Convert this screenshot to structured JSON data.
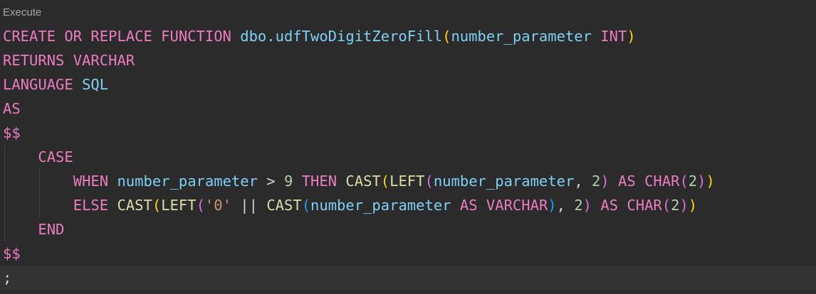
{
  "codelens": {
    "label": "Execute"
  },
  "lines": [
    {
      "tokens": [
        {
          "t": "CREATE OR REPLACE FUNCTION ",
          "c": "keyword"
        },
        {
          "t": "dbo.udfTwoDigitZeroFill",
          "c": "ident"
        },
        {
          "t": "(",
          "c": "paren"
        },
        {
          "t": "number_parameter ",
          "c": "ident"
        },
        {
          "t": "INT",
          "c": "type"
        },
        {
          "t": ")",
          "c": "paren"
        }
      ]
    },
    {
      "tokens": [
        {
          "t": "RETURNS ",
          "c": "keyword"
        },
        {
          "t": "VARCHAR",
          "c": "type"
        }
      ]
    },
    {
      "tokens": [
        {
          "t": "LANGUAGE ",
          "c": "keyword"
        },
        {
          "t": "SQL",
          "c": "ident"
        }
      ]
    },
    {
      "tokens": [
        {
          "t": "AS",
          "c": "keyword"
        }
      ]
    },
    {
      "tokens": [
        {
          "t": "$$",
          "c": "dollar"
        }
      ]
    },
    {
      "indent": 1,
      "tokens": [
        {
          "t": "CASE",
          "c": "keyword"
        }
      ]
    },
    {
      "indent": 2,
      "tokens": [
        {
          "t": "WHEN ",
          "c": "keyword"
        },
        {
          "t": "number_parameter ",
          "c": "ident"
        },
        {
          "t": "> ",
          "c": "op"
        },
        {
          "t": "9 ",
          "c": "number"
        },
        {
          "t": "THEN ",
          "c": "keyword"
        },
        {
          "t": "CAST",
          "c": "func"
        },
        {
          "t": "(",
          "c": "paren"
        },
        {
          "t": "LEFT",
          "c": "func"
        },
        {
          "t": "(",
          "c": "paren2"
        },
        {
          "t": "number_parameter",
          "c": "ident"
        },
        {
          "t": ", ",
          "c": "op"
        },
        {
          "t": "2",
          "c": "number"
        },
        {
          "t": ") ",
          "c": "paren2"
        },
        {
          "t": "AS ",
          "c": "keyword"
        },
        {
          "t": "CHAR",
          "c": "type"
        },
        {
          "t": "(",
          "c": "paren2"
        },
        {
          "t": "2",
          "c": "number"
        },
        {
          "t": ")",
          "c": "paren2"
        },
        {
          "t": ")",
          "c": "paren"
        }
      ]
    },
    {
      "indent": 2,
      "tokens": [
        {
          "t": "ELSE ",
          "c": "keyword"
        },
        {
          "t": "CAST",
          "c": "func"
        },
        {
          "t": "(",
          "c": "paren"
        },
        {
          "t": "LEFT",
          "c": "func"
        },
        {
          "t": "(",
          "c": "paren2"
        },
        {
          "t": "'0' ",
          "c": "string"
        },
        {
          "t": "|| ",
          "c": "op"
        },
        {
          "t": "CAST",
          "c": "func"
        },
        {
          "t": "(",
          "c": "paren3"
        },
        {
          "t": "number_parameter ",
          "c": "ident"
        },
        {
          "t": "AS ",
          "c": "keyword"
        },
        {
          "t": "VARCHAR",
          "c": "type"
        },
        {
          "t": ")",
          "c": "paren3"
        },
        {
          "t": ", ",
          "c": "op"
        },
        {
          "t": "2",
          "c": "number"
        },
        {
          "t": ") ",
          "c": "paren2"
        },
        {
          "t": "AS ",
          "c": "keyword"
        },
        {
          "t": "CHAR",
          "c": "type"
        },
        {
          "t": "(",
          "c": "paren2"
        },
        {
          "t": "2",
          "c": "number"
        },
        {
          "t": ")",
          "c": "paren2"
        },
        {
          "t": ")",
          "c": "paren"
        }
      ]
    },
    {
      "indent": 1,
      "tokens": [
        {
          "t": "END",
          "c": "keyword"
        }
      ]
    },
    {
      "tokens": [
        {
          "t": "$$",
          "c": "dollar"
        }
      ]
    },
    {
      "current": true,
      "tokens": [
        {
          "t": ";",
          "c": "op"
        }
      ]
    }
  ]
}
